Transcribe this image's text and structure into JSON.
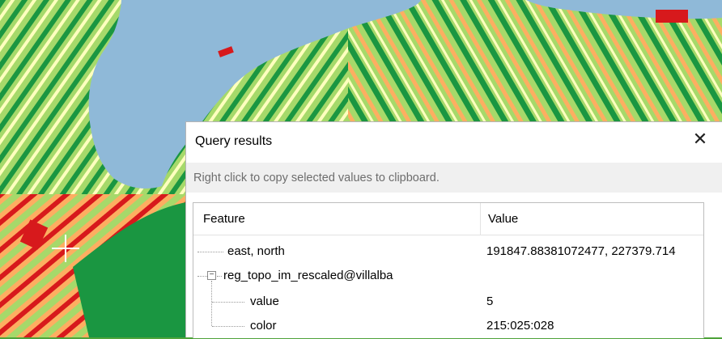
{
  "dialog": {
    "title": "Query results",
    "close_icon": "close-icon",
    "hint": "Right click to copy selected values to clipboard.",
    "columns": [
      "Feature",
      "Value"
    ],
    "rows": [
      {
        "label": "east, north",
        "value": "191847.88381072477, 227379.714"
      },
      {
        "label": "reg_topo_im_rescaled@villalba",
        "value": ""
      },
      {
        "label": "value",
        "value": "5"
      },
      {
        "label": "color",
        "value": "215:025:028"
      }
    ]
  },
  "colors": {
    "water": "#8fb9d8",
    "dark_green": "#1a9641",
    "light_green": "#a6d96a",
    "pale_yellow": "#ffffbf",
    "orange": "#fdae61",
    "red": "#d7191c"
  },
  "map": {
    "cursor_icon": "crosshair-icon"
  }
}
